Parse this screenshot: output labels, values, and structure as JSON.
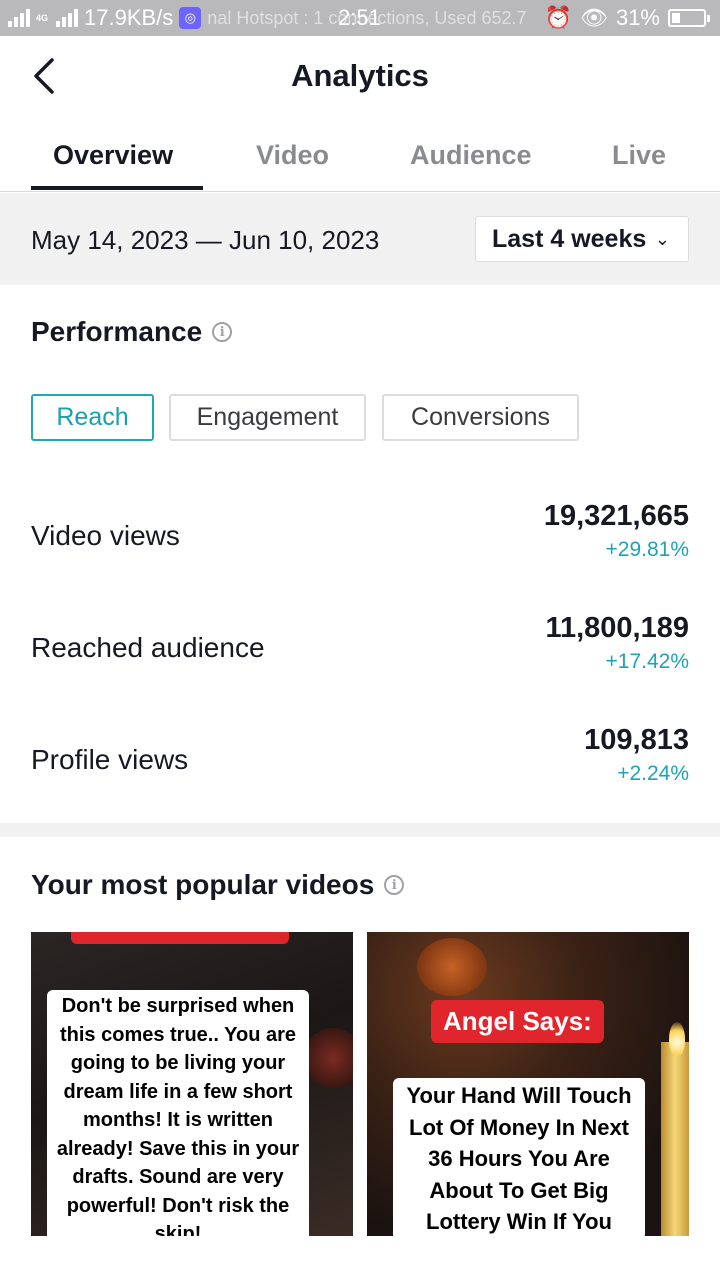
{
  "status_bar": {
    "network_type": "4G",
    "speed": "17.9KB/s",
    "notification_text": "nal Hotspot : 1 connections, Used 652.7",
    "time": "2:51",
    "battery": "31%"
  },
  "header": {
    "title": "Analytics"
  },
  "tabs": [
    {
      "label": "Overview",
      "active": true
    },
    {
      "label": "Video",
      "active": false
    },
    {
      "label": "Audience",
      "active": false
    },
    {
      "label": "Live",
      "active": false
    }
  ],
  "date_filter": {
    "range": "May 14, 2023 — Jun 10, 2023",
    "selected": "Last 4 weeks"
  },
  "performance": {
    "title": "Performance",
    "pills": [
      {
        "label": "Reach",
        "active": true
      },
      {
        "label": "Engagement",
        "active": false
      },
      {
        "label": "Conversions",
        "active": false
      }
    ],
    "metrics": [
      {
        "label": "Video views",
        "value": "19,321,665",
        "change": "+29.81%"
      },
      {
        "label": "Reached audience",
        "value": "11,800,189",
        "change": "+17.42%"
      },
      {
        "label": "Profile views",
        "value": "109,813",
        "change": "+2.24%"
      }
    ]
  },
  "popular_videos": {
    "title": "Your most popular videos",
    "videos": [
      {
        "caption": "Don't be surprised when this comes true.. You are going to be living your dream life in a few short months! It is written already! Save this in your drafts. Sound are very powerful! Don't risk the skip!"
      },
      {
        "badge": "Angel Says:",
        "caption": "Your Hand Will Touch Lot Of Money In Next 36 Hours You Are About To Get Big Lottery Win If You"
      }
    ]
  },
  "colors": {
    "accent": "#1ea3b4",
    "text": "#161823",
    "muted": "#8a8b91",
    "band": "#f1f1f2",
    "badge_red": "#e0252d"
  },
  "icons": {
    "back": "chevron-left-icon",
    "info": "info-icon",
    "dropdown": "chevron-down-icon"
  }
}
